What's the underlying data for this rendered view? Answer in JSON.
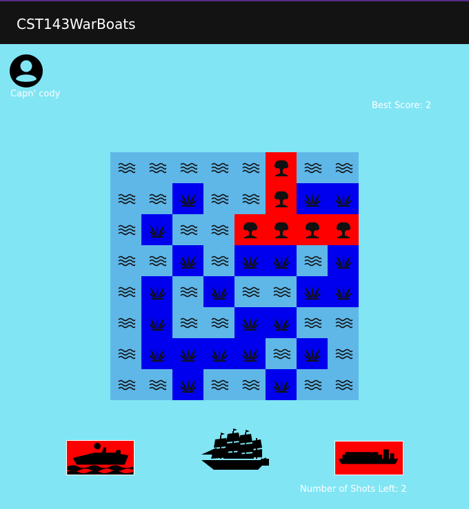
{
  "app": {
    "title": "CST143WarBoats"
  },
  "player": {
    "name": "Capn' cody",
    "avatar_icon": "account-circle-icon"
  },
  "score": {
    "best_label": "Best Score: 2"
  },
  "colors": {
    "water": "#5fb7e8",
    "miss": "#0000ee",
    "hit": "#ff0000",
    "background": "#81e5f4",
    "appbar": "#131313"
  },
  "legend": {
    "w": "water-wave-icon",
    "m": "splash-icon",
    "h": "explosion-icon"
  },
  "board": {
    "rows": [
      [
        "w",
        "w",
        "w",
        "w",
        "w",
        "h",
        "w",
        "w"
      ],
      [
        "w",
        "w",
        "m",
        "w",
        "w",
        "h",
        "m",
        "m"
      ],
      [
        "w",
        "m",
        "w",
        "w",
        "h",
        "h",
        "h",
        "h"
      ],
      [
        "w",
        "w",
        "m",
        "w",
        "m",
        "m",
        "w",
        "m"
      ],
      [
        "w",
        "m",
        "w",
        "m",
        "w",
        "w",
        "m",
        "m"
      ],
      [
        "w",
        "m",
        "w",
        "w",
        "m",
        "m",
        "w",
        "w"
      ],
      [
        "w",
        "m",
        "m",
        "m",
        "m",
        "w",
        "m",
        "w"
      ],
      [
        "w",
        "w",
        "m",
        "w",
        "w",
        "m",
        "w",
        "w"
      ]
    ]
  },
  "ships": [
    {
      "name": "patrol-boat",
      "icon": "gunboat-icon"
    },
    {
      "name": "sailing-ship",
      "icon": "tall-ship-icon"
    },
    {
      "name": "cargo-ship",
      "icon": "container-ship-icon"
    }
  ],
  "status": {
    "shots_label": "Number of Shots Left: 2"
  }
}
